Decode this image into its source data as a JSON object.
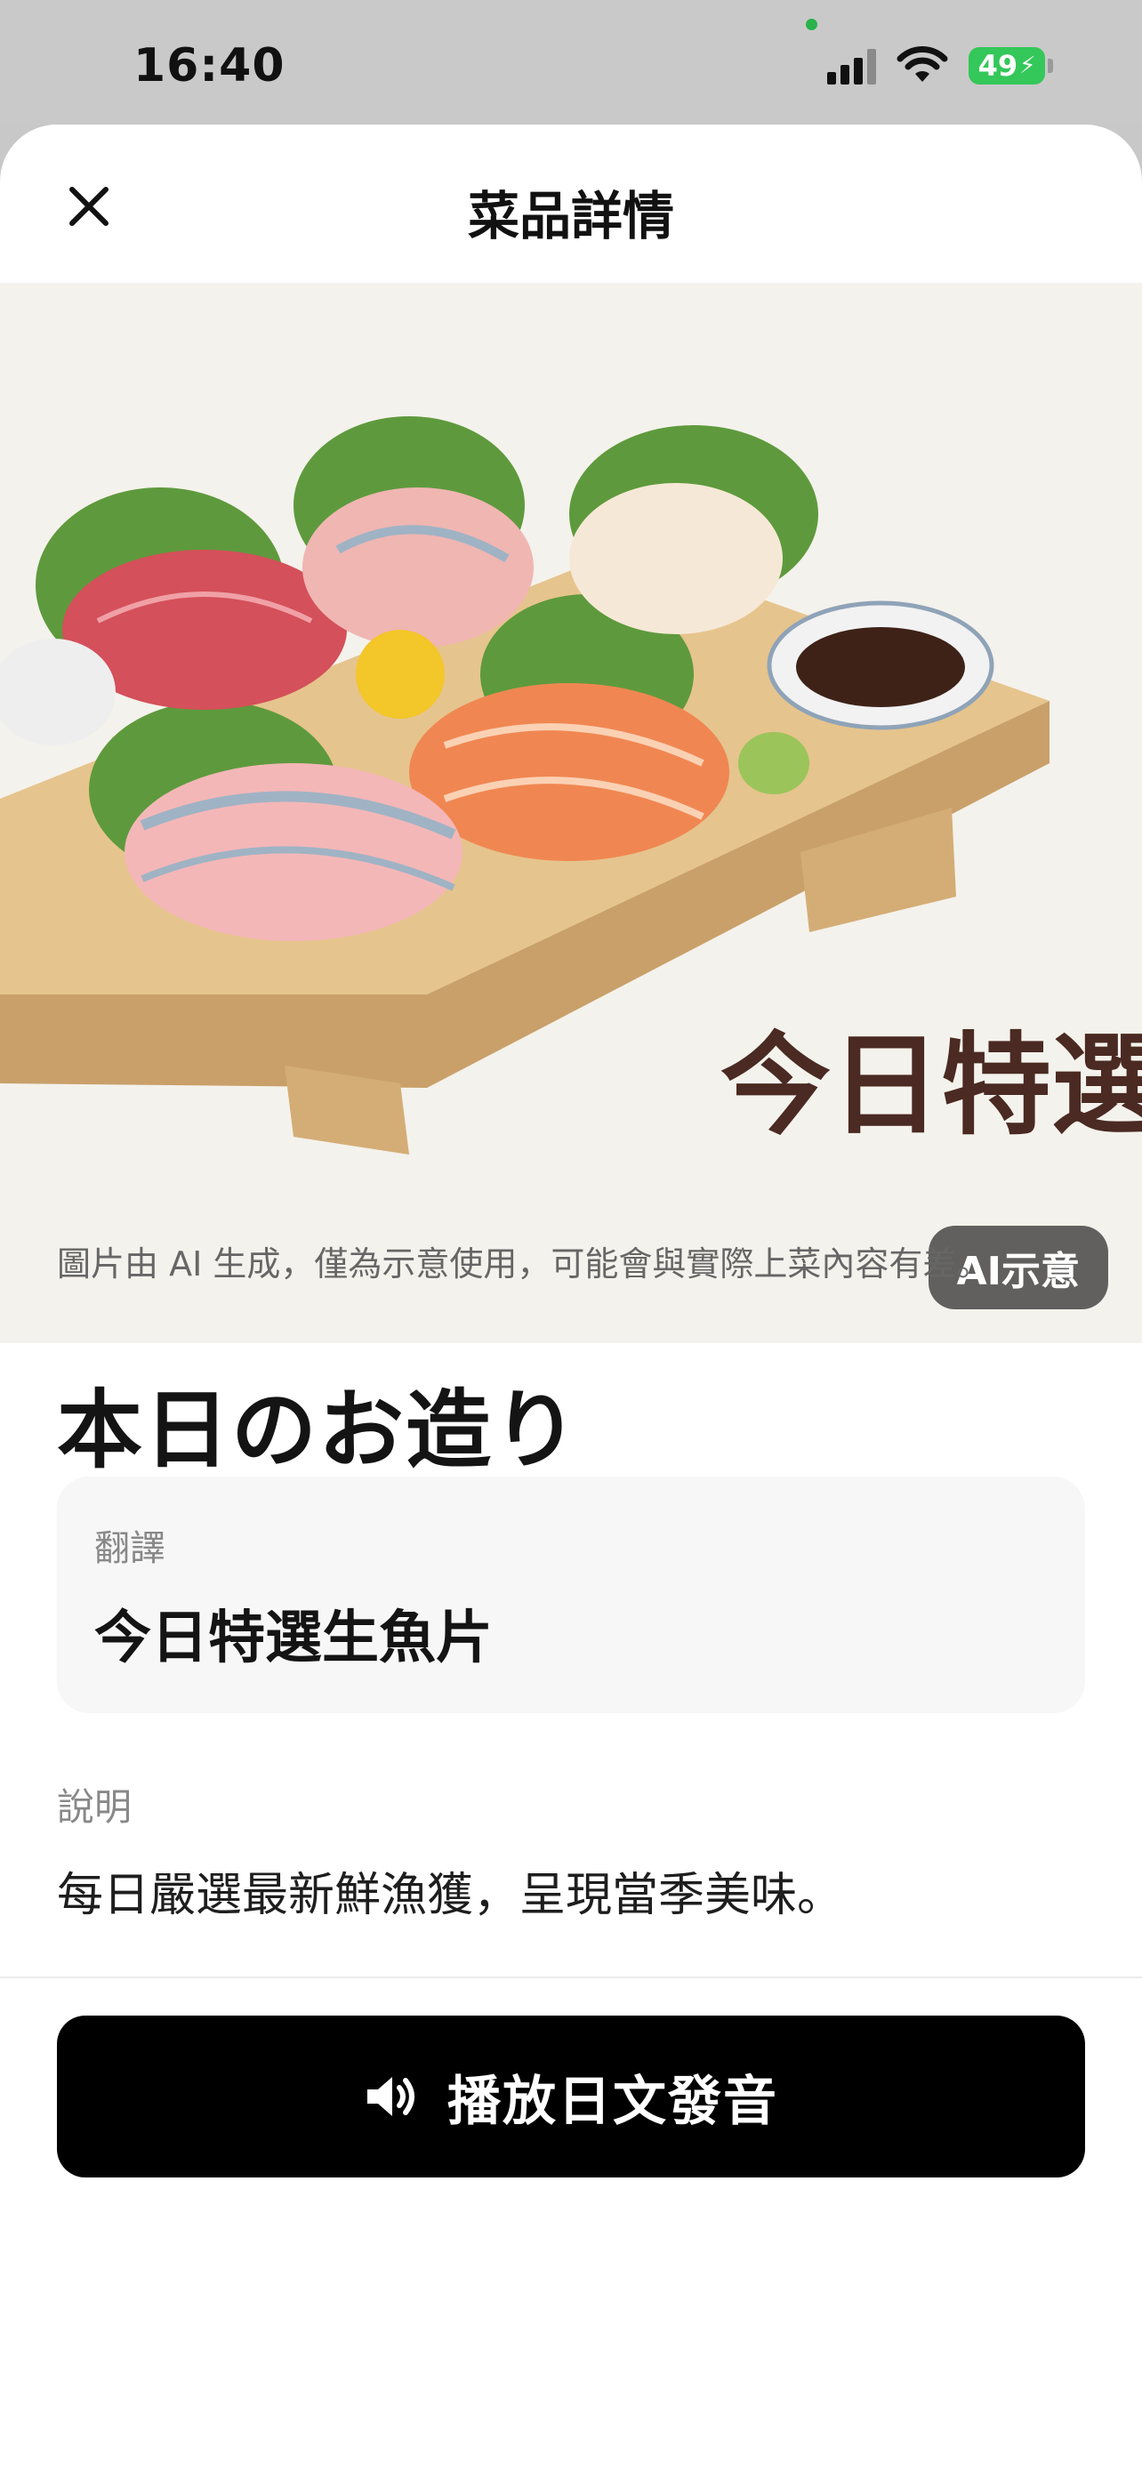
{
  "status_bar": {
    "time": "16:40",
    "battery": "49",
    "icons": [
      "signal-icon",
      "wifi-icon",
      "battery-icon"
    ]
  },
  "header": {
    "title": "菜品詳情",
    "close_icon": "close-icon"
  },
  "hero": {
    "image_text": "今日特選",
    "badge": "AI示意"
  },
  "disclaimer": "圖片由 AI 生成，僅為示意使用，可能會與實際上菜內容有差。",
  "dish": {
    "name": "本日のお造り"
  },
  "translation": {
    "label": "翻譯",
    "value": "今日特選生魚片"
  },
  "description": {
    "label": "說明",
    "text": "每日嚴選最新鮮漁獲，呈現當季美味。"
  },
  "action": {
    "play_label": "播放日文發音",
    "icon": "speaker-icon"
  },
  "colors": {
    "accent": "#000000",
    "badge_bg": "#464646",
    "battery": "#34c759",
    "card_bg": "#f7f7f7"
  }
}
